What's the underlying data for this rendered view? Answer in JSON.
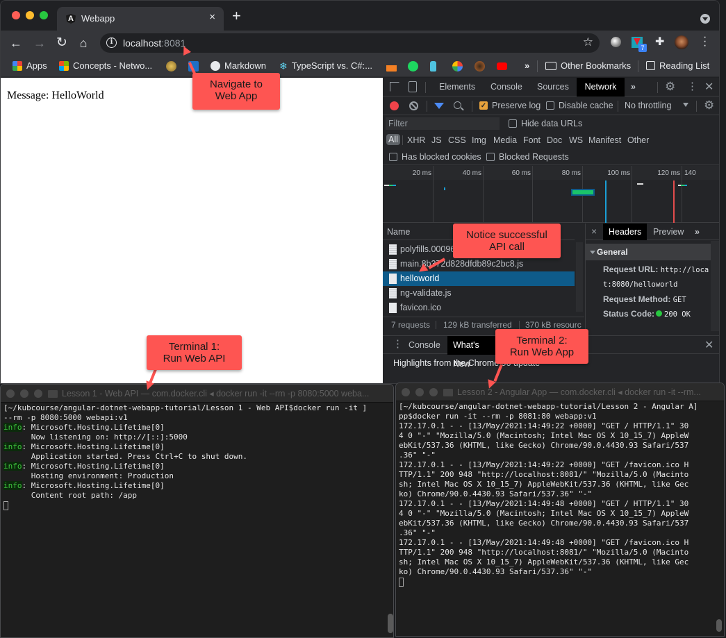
{
  "browser": {
    "tab_title": "Webapp",
    "tab_favicon": "A",
    "url_host": "localhost",
    "url_port": ":8081",
    "ext_badge": "7",
    "bookmarks": [
      {
        "label": "Apps",
        "icon": "apps-grid-icon"
      },
      {
        "label": "Concepts - Netwo...",
        "icon": "microsoft-icon"
      },
      {
        "label": "",
        "icon": "seal-icon"
      },
      {
        "label": "",
        "icon": "vscode-icon"
      },
      {
        "label": "Markdown",
        "icon": "globe-icon"
      },
      {
        "label": "TypeScript vs. C#:...",
        "icon": "snowflake-icon"
      },
      {
        "label": "",
        "icon": "stackoverflow-icon"
      },
      {
        "label": "",
        "icon": "spotify-icon"
      },
      {
        "label": "",
        "icon": "bottle-icon"
      },
      {
        "label": "",
        "icon": "google-icon"
      },
      {
        "label": "",
        "icon": "swirl-icon"
      },
      {
        "label": "",
        "icon": "youtube-icon"
      }
    ],
    "bookmarks_overflow": "»",
    "other_bookmarks": "Other Bookmarks",
    "reading_list": "Reading List"
  },
  "page": {
    "message": "Message: HelloWorld"
  },
  "devtools": {
    "tabs": [
      "Elements",
      "Console",
      "Sources",
      "Network"
    ],
    "active_tab": "Network",
    "more_tabs": "»",
    "preserve_log": {
      "label": "Preserve log",
      "checked": true
    },
    "disable_cache": {
      "label": "Disable cache",
      "checked": false
    },
    "throttling": "No throttling",
    "filter_placeholder": "Filter",
    "hide_data_urls": {
      "label": "Hide data URLs",
      "checked": false
    },
    "type_filters": [
      "All",
      "XHR",
      "JS",
      "CSS",
      "Img",
      "Media",
      "Font",
      "Doc",
      "WS",
      "Manifest",
      "Other"
    ],
    "active_type": "All",
    "has_blocked_cookies": {
      "label": "Has blocked cookies",
      "checked": false
    },
    "blocked_requests": {
      "label": "Blocked Requests",
      "checked": false
    },
    "timeline_ticks": [
      "20 ms",
      "40 ms",
      "60 ms",
      "80 ms",
      "100 ms",
      "120 ms",
      "140"
    ],
    "name_header": "Name",
    "requests": [
      {
        "name": "polyfills.00096",
        "type": "doc"
      },
      {
        "name": "main.8b372d828dfdb89c2bc8.js",
        "type": "doc"
      },
      {
        "name": "helloworld",
        "type": "blank",
        "selected": true
      },
      {
        "name": "ng-validate.js",
        "type": "doc"
      },
      {
        "name": "favicon.ico",
        "type": "blank"
      }
    ],
    "summary": {
      "requests": "7 requests",
      "transferred": "129 kB transferred",
      "resources": "370 kB resourc"
    },
    "detail_tabs": [
      "Headers",
      "Preview"
    ],
    "detail_active": "Headers",
    "detail_close": "×",
    "general_header": "General",
    "general": {
      "request_url_key": "Request URL:",
      "request_url_val1": "http://loca",
      "request_url_val2": "t:8080/helloworld",
      "method_key": "Request Method:",
      "method_val": "GET",
      "status_key": "Status Code:",
      "status_val": "200 OK",
      "status_color": "#28c840"
    },
    "drawer_tabs": [
      "Console",
      "What's New"
    ],
    "drawer_active": "What's New",
    "drawer_content": "Highlights from the Chrome 90 update"
  },
  "terminal1": {
    "title": "Lesson 1 - Web API — com.docker.cli ◂ docker run -it --rm -p 8080:5000 weba...",
    "lines": [
      {
        "text": "[~/kubcourse/angular-dotnet-webapp-tutorial/Lesson 1 - Web API$docker run -it ]"
      },
      {
        "text": "--rm -p 8080:5000 webapi:v1"
      },
      {
        "tag": "info",
        "text": ": Microsoft.Hosting.Lifetime[0]"
      },
      {
        "text": "      Now listening on: http://[::]:5000"
      },
      {
        "tag": "info",
        "text": ": Microsoft.Hosting.Lifetime[0]"
      },
      {
        "text": "      Application started. Press Ctrl+C to shut down."
      },
      {
        "tag": "info",
        "text": ": Microsoft.Hosting.Lifetime[0]"
      },
      {
        "text": "      Hosting environment: Production"
      },
      {
        "tag": "info",
        "text": ": Microsoft.Hosting.Lifetime[0]"
      },
      {
        "text": "      Content root path: /app"
      }
    ]
  },
  "terminal2": {
    "title": "Lesson 2 - Angular App — com.docker.cli ◂ docker run -it --rm...",
    "lines": [
      "[~/kubcourse/angular-dotnet-webapp-tutorial/Lesson 2 - Angular A]",
      "pp$docker run -it --rm -p 8081:80 webapp:v1",
      "172.17.0.1 - - [13/May/2021:14:49:22 +0000] \"GET / HTTP/1.1\" 30",
      "4 0 \"-\" \"Mozilla/5.0 (Macintosh; Intel Mac OS X 10_15_7) AppleW",
      "ebKit/537.36 (KHTML, like Gecko) Chrome/90.0.4430.93 Safari/537",
      ".36\" \"-\"",
      "172.17.0.1 - - [13/May/2021:14:49:22 +0000] \"GET /favicon.ico H",
      "TTP/1.1\" 200 948 \"http://localhost:8081/\" \"Mozilla/5.0 (Macinto",
      "sh; Intel Mac OS X 10_15_7) AppleWebKit/537.36 (KHTML, like Gec",
      "ko) Chrome/90.0.4430.93 Safari/537.36\" \"-\"",
      "172.17.0.1 - - [13/May/2021:14:49:48 +0000] \"GET / HTTP/1.1\" 30",
      "4 0 \"-\" \"Mozilla/5.0 (Macintosh; Intel Mac OS X 10_15_7) AppleW",
      "ebKit/537.36 (KHTML, like Gecko) Chrome/90.0.4430.93 Safari/537",
      ".36\" \"-\"",
      "172.17.0.1 - - [13/May/2021:14:49:48 +0000] \"GET /favicon.ico H",
      "TTP/1.1\" 200 948 \"http://localhost:8081/\" \"Mozilla/5.0 (Macinto",
      "sh; Intel Mac OS X 10_15_7) AppleWebKit/537.36 (KHTML, like Gec",
      "ko) Chrome/90.0.4430.93 Safari/537.36\" \"-\""
    ]
  },
  "callouts": {
    "navigate": "Navigate to\nWeb App",
    "api_call": "Notice successful\nAPI call",
    "terminal1": "Terminal 1:\nRun Web API",
    "terminal2": "Terminal 2:\nRun Web App",
    "color": "#fe5552"
  }
}
